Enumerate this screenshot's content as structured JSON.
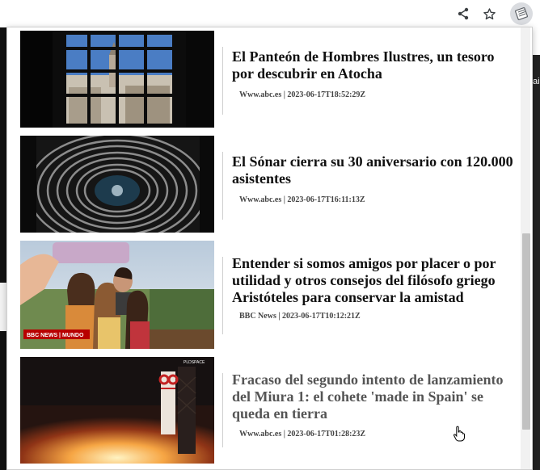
{
  "toolbar": {
    "share_icon": "share-icon",
    "bookmark_icon": "star-icon",
    "extension_icon": "extension-icon"
  },
  "background": {
    "partial_text": "ail"
  },
  "articles": [
    {
      "title": "El Panteón de Hombres Ilustres, un tesoro por descubrir en Atocha",
      "source": "Www.abc.es",
      "date": "2023-06-17T18:52:29Z",
      "meta": "Www.abc.es | 2023-06-17T18:52:29Z"
    },
    {
      "title": "El Sónar cierra su 30 aniversario con 120.000 asistentes",
      "source": "Www.abc.es",
      "date": "2023-06-17T16:11:13Z",
      "meta": "Www.abc.es | 2023-06-17T16:11:13Z"
    },
    {
      "title": "Entender si somos amigos por placer o por utilidad y otros consejos del filósofo griego Aristóteles para conservar la amistad",
      "source": "BBC News",
      "date": "2023-06-17T10:12:21Z",
      "meta": "BBC News | 2023-06-17T10:12:21Z",
      "image_badge": "BBC NEWS | MUNDO"
    },
    {
      "title": "Fracaso del segundo intento de lanzamiento del Miura 1: el cohete 'made in Spain' se queda en tierra",
      "source": "Www.abc.es",
      "date": "2023-06-17T01:28:23Z",
      "meta": "Www.abc.es | 2023-06-17T01:28:23Z",
      "image_badge": "PLDSPACE"
    }
  ]
}
